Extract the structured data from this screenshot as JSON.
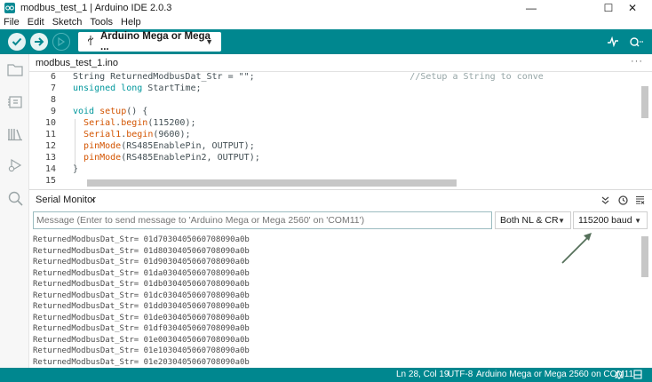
{
  "window": {
    "title": "modbus_test_1 | Arduino IDE 2.0.3",
    "controls": {
      "minimize": "—",
      "maximize": "☐",
      "close": "✕"
    }
  },
  "menu": [
    "File",
    "Edit",
    "Sketch",
    "Tools",
    "Help"
  ],
  "toolbar": {
    "board": "Arduino Mega or Mega ...",
    "icons": [
      "verify-icon",
      "upload-icon",
      "debug-icon",
      "usb-icon",
      "serial-plotter-icon",
      "serial-monitor-icon"
    ]
  },
  "sidebar": [
    "sketchbook-icon",
    "boards-manager-icon",
    "library-manager-icon",
    "debug-icon",
    "search-icon"
  ],
  "editor": {
    "tab": "modbus_test_1.ino",
    "more": "···",
    "lines": [
      {
        "n": "6",
        "segments": [
          {
            "t": "String ReturnedModbusDat_Str = \"\";",
            "c": "tx"
          },
          {
            "t": "                             //Setup a String to conve",
            "c": "cm"
          }
        ]
      },
      {
        "n": "7",
        "segments": [
          {
            "t": "unsigned long ",
            "c": "kw"
          },
          {
            "t": "StartTime;",
            "c": "tx"
          }
        ]
      },
      {
        "n": "8",
        "segments": []
      },
      {
        "n": "9",
        "segments": [
          {
            "t": "void ",
            "c": "kw"
          },
          {
            "t": "setup",
            "c": "fn"
          },
          {
            "t": "() {",
            "c": "tx"
          }
        ]
      },
      {
        "n": "10",
        "segments": [
          {
            "t": "  ",
            "c": "tx"
          },
          {
            "t": "Serial",
            "c": "fn"
          },
          {
            "t": ".",
            "c": "tx"
          },
          {
            "t": "begin",
            "c": "fn"
          },
          {
            "t": "(115200);",
            "c": "tx"
          }
        ]
      },
      {
        "n": "11",
        "segments": [
          {
            "t": "  ",
            "c": "tx"
          },
          {
            "t": "Serial1",
            "c": "fn"
          },
          {
            "t": ".",
            "c": "tx"
          },
          {
            "t": "begin",
            "c": "fn"
          },
          {
            "t": "(9600);",
            "c": "tx"
          }
        ]
      },
      {
        "n": "12",
        "segments": [
          {
            "t": "  ",
            "c": "tx"
          },
          {
            "t": "pinMode",
            "c": "fn"
          },
          {
            "t": "(RS485EnablePin, OUTPUT);",
            "c": "tx"
          }
        ]
      },
      {
        "n": "13",
        "segments": [
          {
            "t": "  ",
            "c": "tx"
          },
          {
            "t": "pinMode",
            "c": "fn"
          },
          {
            "t": "(RS485EnablePin2, OUTPUT);",
            "c": "tx"
          }
        ]
      },
      {
        "n": "14",
        "segments": [
          {
            "t": "}",
            "c": "tx"
          }
        ]
      },
      {
        "n": "15",
        "segments": []
      }
    ]
  },
  "serial_monitor": {
    "title": "Serial Monitor",
    "close": "×",
    "input_placeholder": "Message (Enter to send message to 'Arduino Mega or Mega 2560' on 'COM11')",
    "line_ending": "Both NL & CR",
    "baud": "115200 baud",
    "output": [
      "ReturnedModbusDat_Str= 01d7030405060708090a0b",
      "ReturnedModbusDat_Str= 01d8030405060708090a0b",
      "ReturnedModbusDat_Str= 01d9030405060708090a0b",
      "ReturnedModbusDat_Str= 01da030405060708090a0b",
      "ReturnedModbusDat_Str= 01db030405060708090a0b",
      "ReturnedModbusDat_Str= 01dc030405060708090a0b",
      "ReturnedModbusDat_Str= 01dd030405060708090a0b",
      "ReturnedModbusDat_Str= 01de030405060708090a0b",
      "ReturnedModbusDat_Str= 01df030405060708090a0b",
      "ReturnedModbusDat_Str= 01e0030405060708090a0b",
      "ReturnedModbusDat_Str= 01e1030405060708090a0b",
      "ReturnedModbusDat_Str= 01e2030405060708090a0b"
    ]
  },
  "status": {
    "position": "Ln 28, Col 19",
    "encoding": "UTF-8",
    "board_port": "Arduino Mega or Mega 2560 on COM11"
  },
  "colors": {
    "teal": "#00878f",
    "keyword": "#00979c",
    "function": "#d35400",
    "comment": "#95a5a6",
    "arrow": "#55705a"
  }
}
